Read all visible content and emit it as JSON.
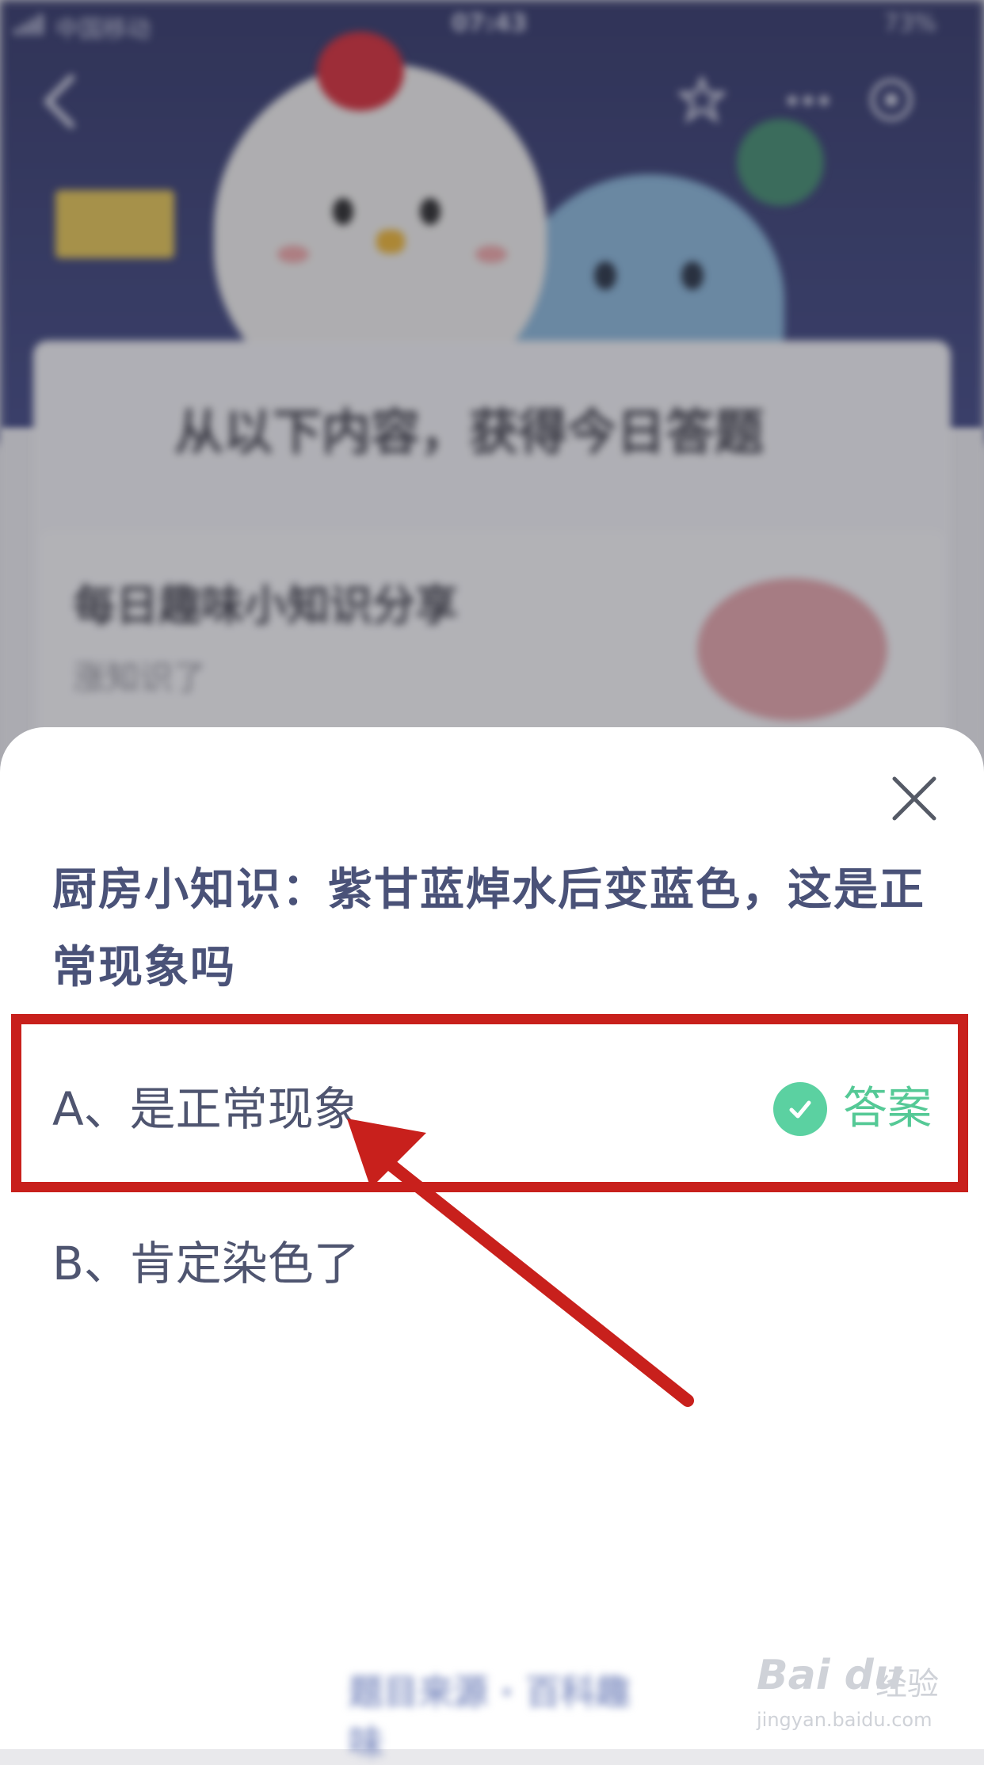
{
  "background_app": {
    "status_bar": {
      "carrier": "中国移动",
      "time": "07:43",
      "battery": "73%"
    },
    "card_title": "从以下内容，获得今日答题",
    "inner_card": {
      "title": "每日趣味小知识分享",
      "subtitle": "涨知识了"
    },
    "footer": "题目来源 · 百科趣味"
  },
  "quiz": {
    "question": "厨房小知识：紫甘蓝焯水后变蓝色，这是正常现象吗",
    "options": [
      {
        "label": "A、是正常现象",
        "is_answer": true
      },
      {
        "label": "B、肯定染色了",
        "is_answer": false
      }
    ],
    "answer_tag": "答案",
    "close_icon": "close-icon",
    "check_icon": "check-icon"
  },
  "annotation": {
    "highlight_color": "#c8201c",
    "arrow_color": "#c8201c"
  },
  "watermark": {
    "brand": "Bai du",
    "brand_cn": "经验",
    "url": "jingyan.baidu.com"
  },
  "colors": {
    "question_text": "#4a5278",
    "answer_green": "#55c996",
    "check_bg": "#5bd1a1"
  }
}
